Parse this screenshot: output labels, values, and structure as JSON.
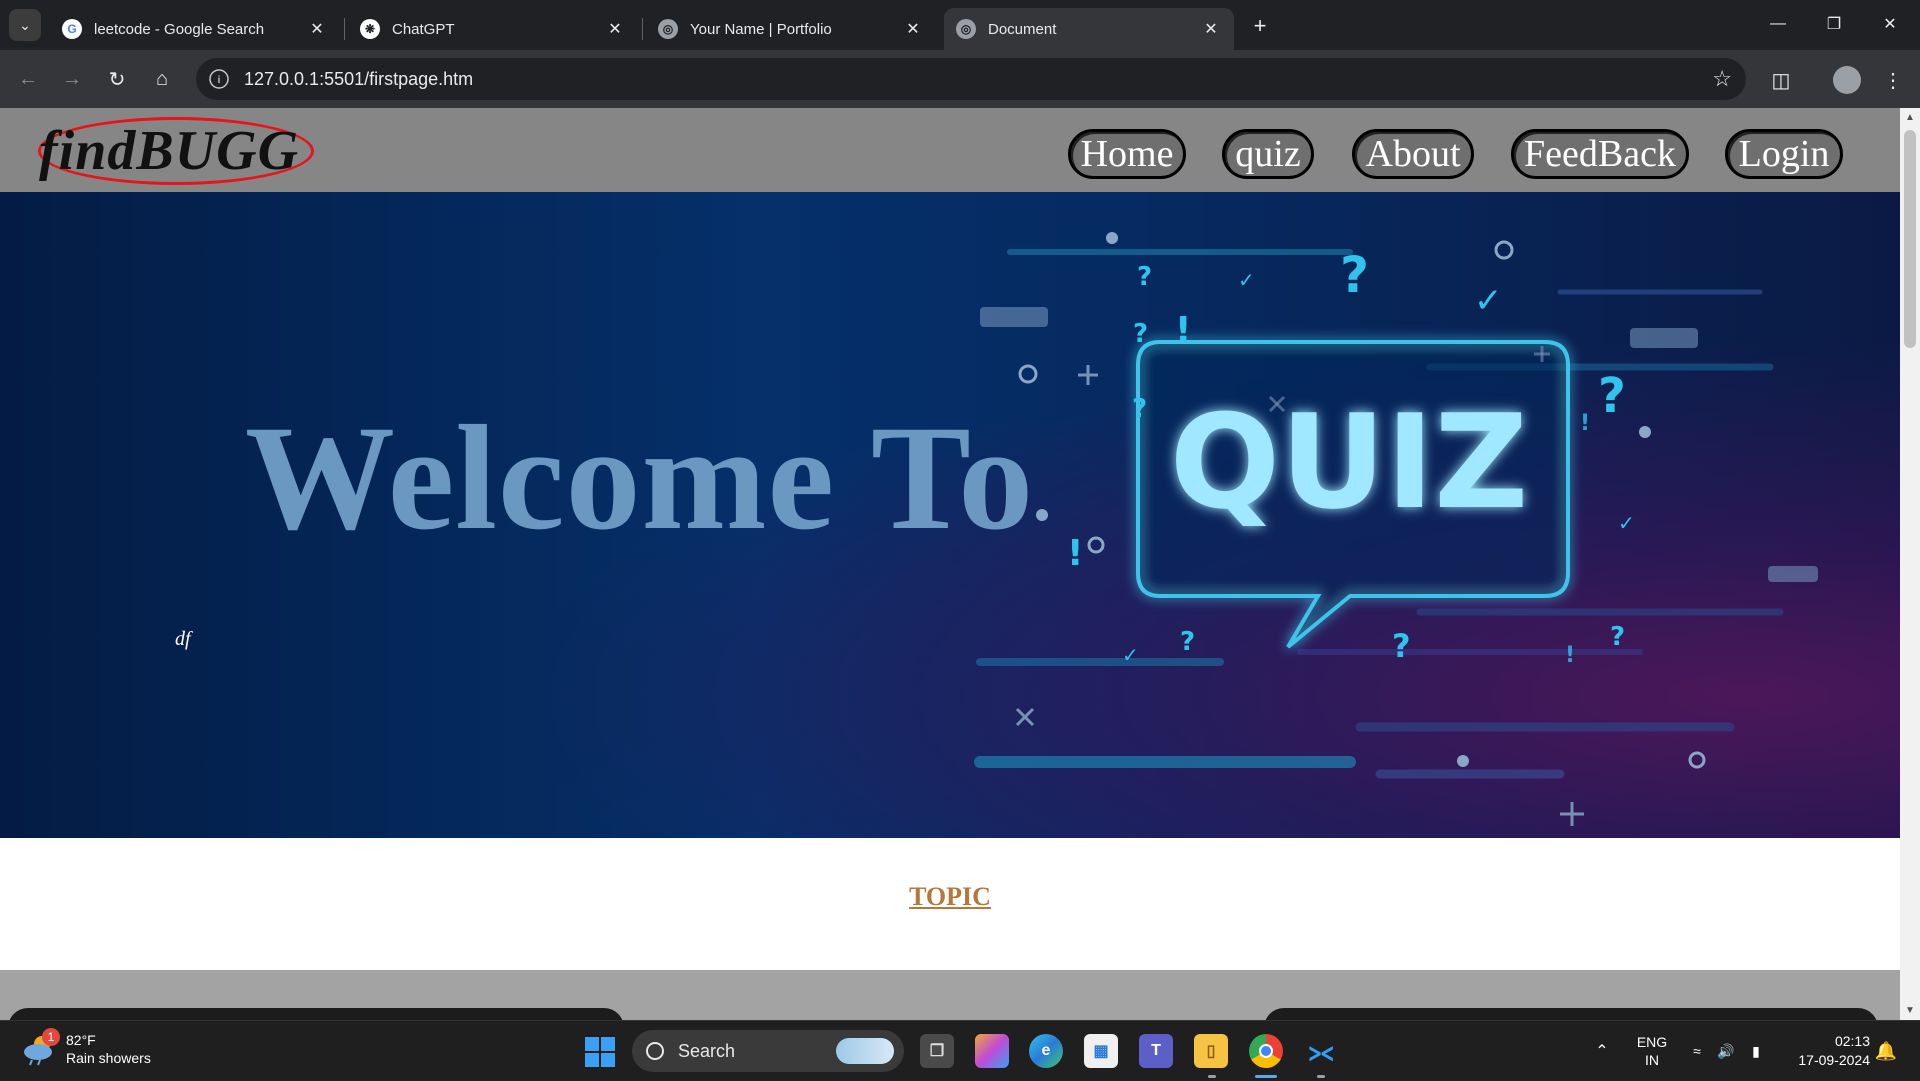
{
  "browser": {
    "tabs": [
      {
        "title": "leetcode - Google Search",
        "favicon": "google-g-icon"
      },
      {
        "title": "ChatGPT",
        "favicon": "chatgpt-icon"
      },
      {
        "title": "Your Name | Portfolio",
        "favicon": "globe-icon"
      },
      {
        "title": "Document",
        "favicon": "globe-icon",
        "active": true
      }
    ],
    "url": "127.0.0.1:5501/firstpage.htm"
  },
  "site": {
    "logo": "findBUGG",
    "nav": [
      "Home",
      "quiz",
      "About",
      "FeedBack",
      "Login"
    ],
    "hero": {
      "heading": "Welcome To",
      "quiz_word": "QUIZ",
      "stray_text": "df"
    },
    "topic_label": "TOPIC"
  },
  "taskbar": {
    "weather": {
      "temp": "82°F",
      "condition": "Rain showers",
      "badge": "1"
    },
    "search_label": "Search",
    "lang_line1": "ENG",
    "lang_line2": "IN",
    "time": "02:13",
    "date": "17-09-2024"
  },
  "colors": {
    "header_bg": "#868686",
    "logo_ring": "#e4161b",
    "hero_heading": "#6b98c1",
    "topic": "#b5773a",
    "quiz_glow": "#8fe3ff"
  }
}
